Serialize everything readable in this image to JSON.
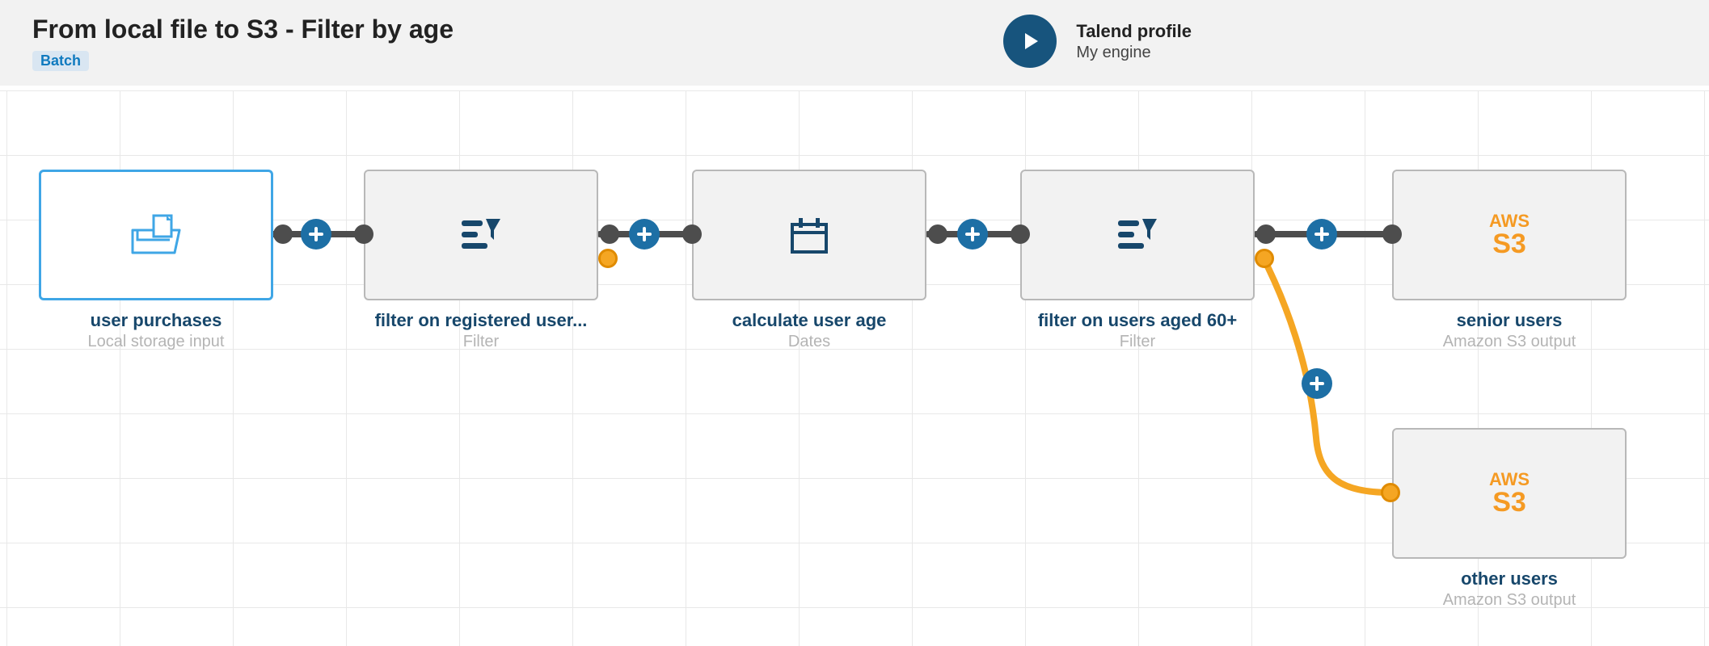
{
  "header": {
    "title": "From local file to S3 - Filter by age",
    "badge": "Batch",
    "profile_label": "Talend profile",
    "profile_value": "My engine"
  },
  "nodes": {
    "n1": {
      "title": "user purchases",
      "subtitle": "Local storage input",
      "icon": "folder-file-icon"
    },
    "n2": {
      "title": "filter on registered user...",
      "subtitle": "Filter",
      "icon": "filter-icon"
    },
    "n3": {
      "title": "calculate user age",
      "subtitle": "Dates",
      "icon": "calendar-icon"
    },
    "n4": {
      "title": "filter on users aged 60+",
      "subtitle": "Filter",
      "icon": "filter-icon"
    },
    "n5": {
      "title": "senior users",
      "subtitle": "Amazon S3 output",
      "icon": "aws-s3",
      "aws_top": "AWS",
      "aws_s3": "S3"
    },
    "n6": {
      "title": "other users",
      "subtitle": "Amazon S3 output",
      "icon": "aws-s3",
      "aws_top": "AWS",
      "aws_s3": "S3"
    }
  },
  "colors": {
    "accent_blue": "#1d6fa5",
    "select_blue": "#3fa6e6",
    "port_dark": "#4d4d4d",
    "port_orange": "#f5a623",
    "aws_orange": "#f59a23",
    "title_dark": "#17476b"
  }
}
